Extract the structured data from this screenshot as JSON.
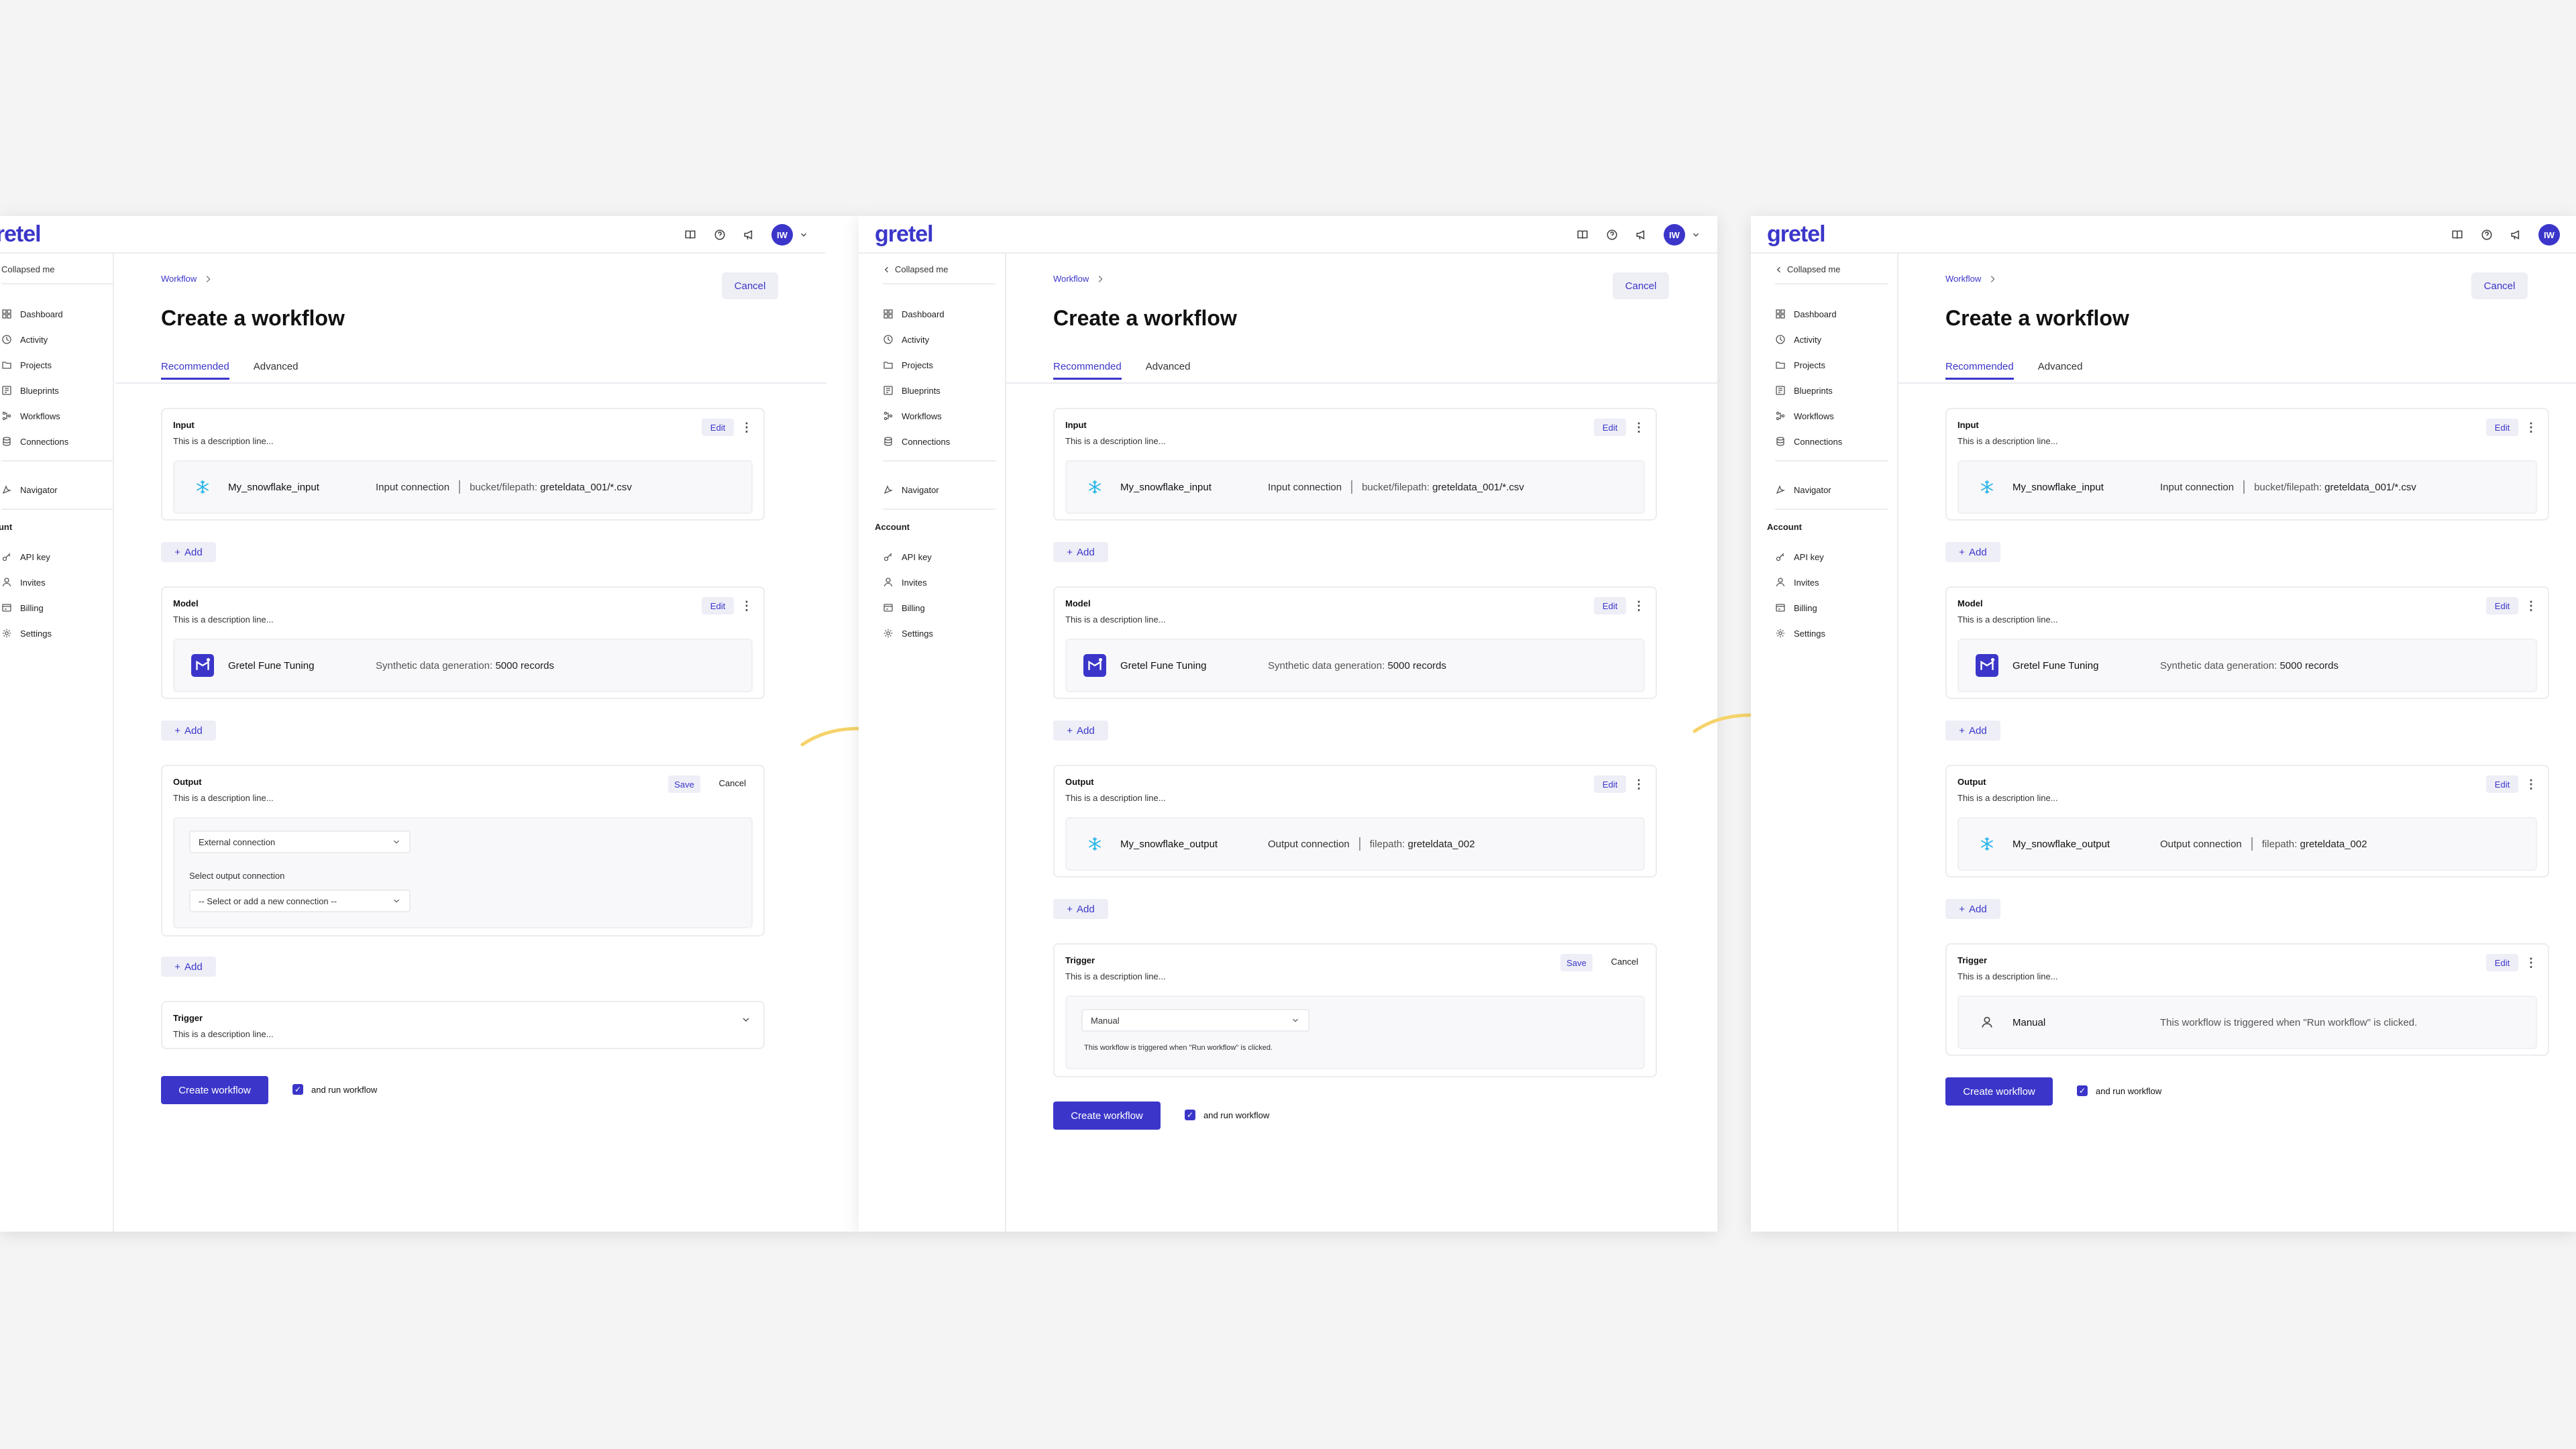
{
  "brand": {
    "logo": "gretel",
    "logo_clip": "retel",
    "accent": "#3b36c9"
  },
  "topbar": {
    "avatar_initials": "IW"
  },
  "sidebar": {
    "collapse_label": "Collapsed me",
    "nav": [
      "Dashboard",
      "Activity",
      "Projects",
      "Blueprints",
      "Workflows",
      "Connections"
    ],
    "navigator": "Navigator",
    "account_header": "Account",
    "account_header_clip": "ount",
    "account": [
      "API key",
      "Invites",
      "Billing",
      "Settings"
    ]
  },
  "header": {
    "breadcrumb": "Workflow",
    "title": "Create a workflow",
    "cancel": "Cancel"
  },
  "tabs": [
    "Recommended",
    "Advanced"
  ],
  "common": {
    "edit": "Edit",
    "save": "Save",
    "cancel": "Cancel",
    "add": "Add",
    "description": "This is a description line...",
    "create": "Create workflow",
    "run": "and run workflow"
  },
  "input": {
    "title": "Input",
    "name": "My_snowflake_input",
    "kind": "Input connection",
    "path_label": "bucket/filepath:",
    "path_value": "greteldata_001/*.csv"
  },
  "model": {
    "title": "Model",
    "name": "Gretel Fune Tuning",
    "kind": "Synthetic data generation:",
    "value": "5000 records"
  },
  "output": {
    "title": "Output",
    "name": "My_snowflake_output",
    "kind": "Output connection",
    "path_label": "filepath:",
    "path_value": "greteldata_002",
    "select_type": "External connection",
    "select_label": "Select output connection",
    "select_placeholder": "-- Select or add a new connection --"
  },
  "trigger": {
    "title": "Trigger",
    "value": "Manual",
    "note": "This workflow is triggered when \"Run workflow\" is clicked."
  }
}
